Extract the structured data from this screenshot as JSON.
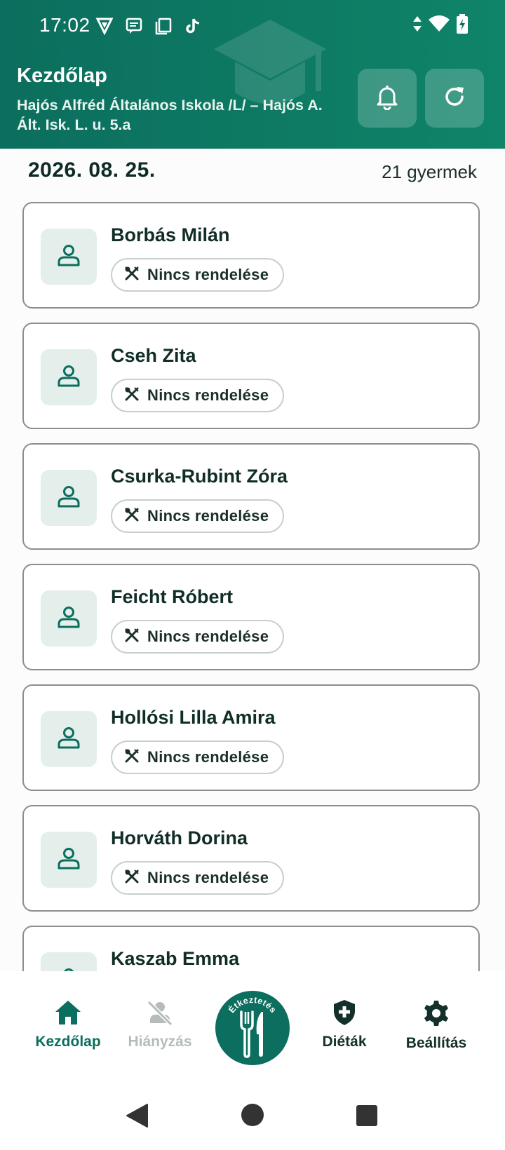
{
  "status_bar": {
    "time": "17:02"
  },
  "header": {
    "title": "Kezdőlap",
    "school": "Hajós Alfréd Általános Iskola /L/ – Hajós A. Ált. Isk.  L. u. 5.a",
    "bell_icon": "bell-icon",
    "refresh_icon": "refresh-icon"
  },
  "summary": {
    "date": "2026. 08. 25.",
    "count": "21 gyermek"
  },
  "children": [
    {
      "name": "Borbás Milán",
      "status": "Nincs rendelése"
    },
    {
      "name": "Cseh Zita",
      "status": "Nincs rendelése"
    },
    {
      "name": "Csurka-Rubint Zóra",
      "status": "Nincs rendelése"
    },
    {
      "name": "Feicht Róbert",
      "status": "Nincs rendelése"
    },
    {
      "name": "Hollósi Lilla Amira",
      "status": "Nincs rendelése"
    },
    {
      "name": "Horváth Dorina",
      "status": "Nincs rendelése"
    },
    {
      "name": "Kaszab Emma",
      "status": ""
    }
  ],
  "bottom_nav": {
    "home": "Kezdőlap",
    "absence": "Hiányzás",
    "center_label": "Étkeztetés",
    "diets": "Diéták",
    "settings": "Beállítás"
  },
  "colors": {
    "primary": "#0c6e5e",
    "disabled": "#b5bcba",
    "card_border": "#8a8f8d"
  }
}
